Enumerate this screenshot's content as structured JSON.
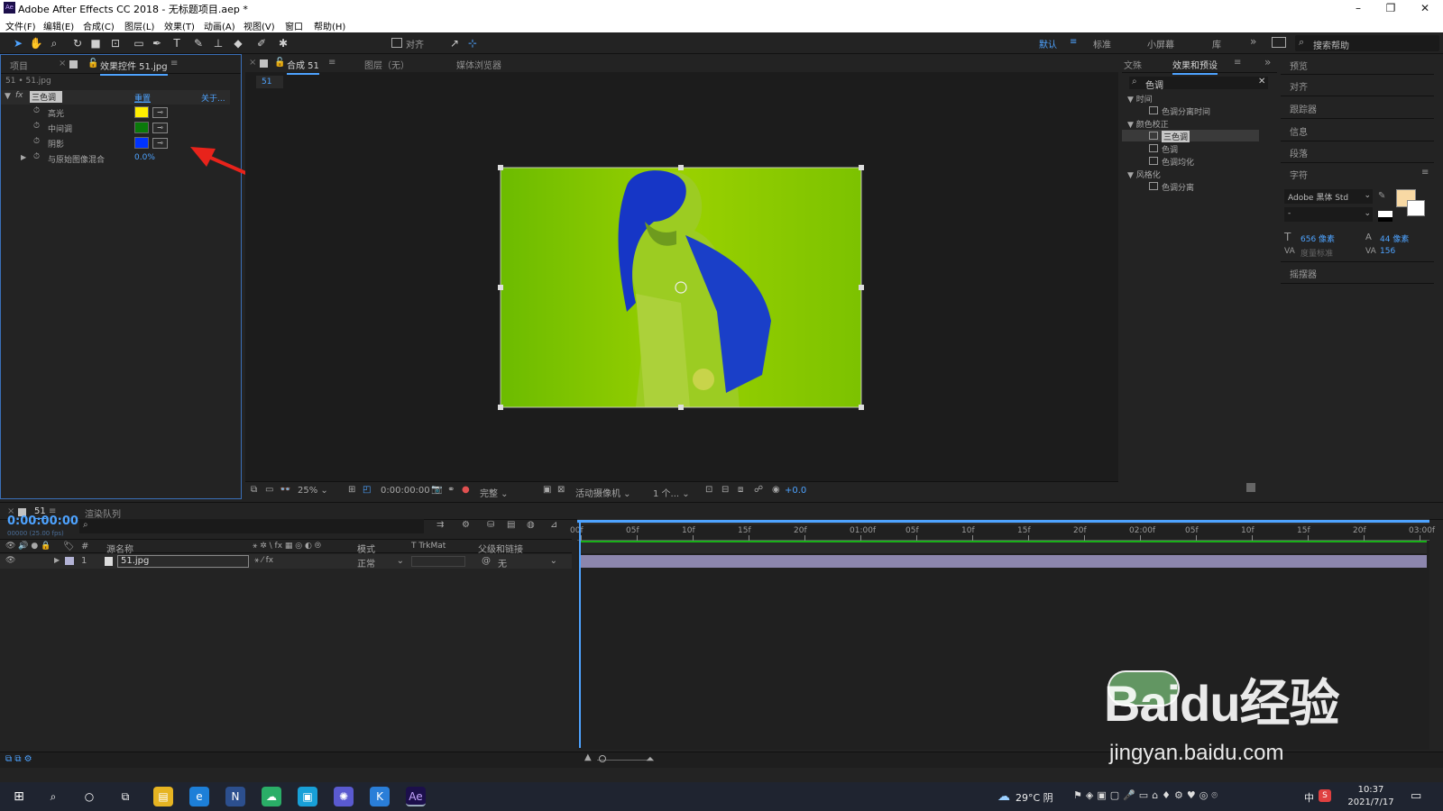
{
  "window": {
    "title": "Adobe After Effects CC 2018 - 无标题项目.aep *",
    "app_icon": "Ae"
  },
  "menu": [
    "文件(F)",
    "编辑(E)",
    "合成(C)",
    "图层(L)",
    "效果(T)",
    "动画(A)",
    "视图(V)",
    "窗口",
    "帮助(H)"
  ],
  "toolbar": {
    "align_label": "对齐",
    "workspaces": [
      "默认",
      "标准",
      "小屏幕",
      "库"
    ],
    "search_placeholder": "搜索帮助"
  },
  "left_panel": {
    "tab_project": "项目",
    "tab_effects": "效果控件 51.jpg",
    "breadcrumb": "51 • 51.jpg",
    "effect": {
      "fx": "fx",
      "name": "三色调",
      "reset": "重置",
      "about": "关于..."
    },
    "props": [
      {
        "label": "高光",
        "color": "#ffee00"
      },
      {
        "label": "中间调",
        "color": "#0a7a0a"
      },
      {
        "label": "阴影",
        "color": "#0033ff"
      }
    ],
    "blend_label": "与原始图像混合",
    "blend_value": "0.0%"
  },
  "comp_panel": {
    "tab_comp": "合成 51",
    "tab_layer": "图层（无）",
    "tab_footage": "媒体浏览器",
    "comp_chip": "51",
    "zoom": "25%",
    "time": "0:00:00:00",
    "quality": "完整",
    "camera": "活动摄像机",
    "views": "1 个...",
    "exposure": "+0.0"
  },
  "effects_panel": {
    "tab_text": "文殊",
    "tab_effects": "效果和预设",
    "search": "色调",
    "tree": [
      {
        "kind": "group",
        "label": "▼ 时间"
      },
      {
        "kind": "item",
        "label": "色调分离时间"
      },
      {
        "kind": "group",
        "label": "▼ 颜色校正"
      },
      {
        "kind": "item",
        "label": "三色调",
        "selected": true
      },
      {
        "kind": "item",
        "label": "色调"
      },
      {
        "kind": "item",
        "label": "色调均化"
      },
      {
        "kind": "group",
        "label": "▼ 风格化"
      },
      {
        "kind": "item",
        "label": "色调分离"
      }
    ]
  },
  "far_right": {
    "sections": [
      "预览",
      "对齐",
      "跟踪器",
      "信息",
      "段落",
      "字符"
    ],
    "font_name": "Adobe 黑体 Std",
    "font_style": "-",
    "font_size": "656 像素",
    "leading": "44 像素",
    "kerning": "度量标准",
    "tracking": "156",
    "wiggler": "摇摆器",
    "fill_color": "#f8d9a4"
  },
  "timeline": {
    "tab_comp": "51",
    "tab_render": "渲染队列",
    "timecode": "0:00:00:00",
    "fps": "00000 (25.00 fps)",
    "col_source": "源名称",
    "col_mode": "模式",
    "col_trkmat": "T  TrkMat",
    "col_parent": "父级和链接",
    "layer": {
      "num": "1",
      "name": "51.jpg",
      "mode": "正常",
      "parent": "无"
    },
    "ruler": [
      "00f",
      "05f",
      "10f",
      "15f",
      "20f",
      "01:00f",
      "05f",
      "10f",
      "15f",
      "20f",
      "02:00f",
      "05f",
      "10f",
      "15f",
      "20f",
      "03:00f"
    ]
  },
  "taskbar": {
    "weather": "29°C 阴",
    "time": "10:37",
    "date": "2021/7/17",
    "ime": "中"
  },
  "watermark": {
    "logo": "Baidu经验",
    "url": "jingyan.baidu.com"
  }
}
